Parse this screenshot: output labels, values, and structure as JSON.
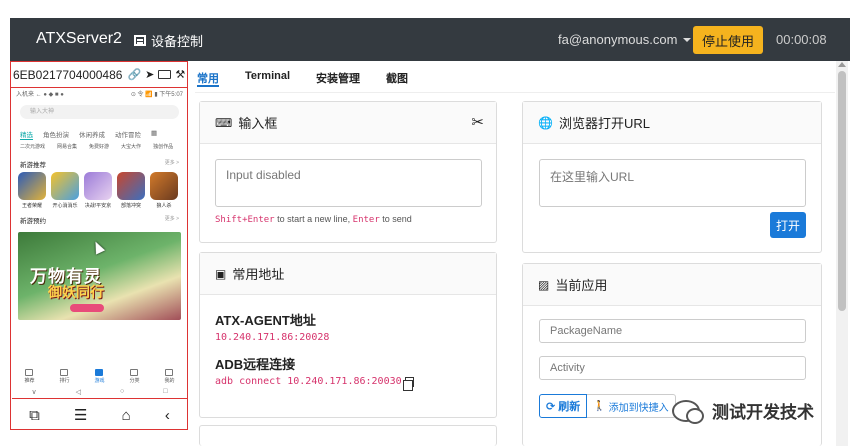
{
  "navbar": {
    "brand": "ATXServer2",
    "device_control_label": "设备控制",
    "user_email": "fa@anonymous.com",
    "stop_button": "停止使用",
    "timer": "00:00:08"
  },
  "device": {
    "serial": "6EB0217704000486",
    "status_left": "入机来 ← ● ◆ ■ ●",
    "status_right": "⊙ 令 📶 ▮ 下午5:07",
    "search_placeholder": "输入大神",
    "app_tabs": [
      "精选",
      "角色扮演",
      "休闲养成",
      "动作冒险"
    ],
    "sub_row": [
      "二次元游戏",
      "网易合集",
      "免费好游",
      "大宝大作",
      "独创作品"
    ],
    "recommend_title": "新游推荐",
    "more": "更多 >",
    "games": [
      {
        "label": "王者荣耀",
        "color": "#2c5bb8"
      },
      {
        "label": "开心消消乐",
        "color": "#f5c22a"
      },
      {
        "label": "决战!平安京",
        "color": "#9b7bd8"
      },
      {
        "label": "部落冲突",
        "color": "#c9462c"
      },
      {
        "label": "狼人杀",
        "color": "#d27a2a"
      }
    ],
    "new_title": "新游预约",
    "banner_line1": "万物有灵",
    "banner_line2": "御妖同行",
    "bottom_tabs": [
      "推荐",
      "排行",
      "游戏",
      "分类",
      "我的"
    ],
    "sys_nav": [
      "∨",
      "◁",
      "○",
      "□"
    ],
    "controls": [
      "⧉",
      "☰",
      "⌂",
      "‹"
    ]
  },
  "tabs": [
    "常用",
    "Terminal",
    "安装管理",
    "截图"
  ],
  "input_card": {
    "title": "输入框",
    "placeholder": "Input disabled",
    "hint_key1": "Shift+Enter",
    "hint_mid": " to start a new line, ",
    "hint_key2": "Enter",
    "hint_end": " to send"
  },
  "address_card": {
    "title": "常用地址",
    "agent_title": "ATX-AGENT地址",
    "agent_value": "10.240.171.86:20028",
    "adb_title": "ADB远程连接",
    "adb_value": "adb connect 10.240.171.86:20030"
  },
  "browser_card": {
    "title": "浏览器打开URL",
    "placeholder": "在这里输入URL",
    "open_button": "打开"
  },
  "app_card": {
    "title": "当前应用",
    "package_placeholder": "PackageName",
    "activity_placeholder": "Activity",
    "refresh_button": "刷新",
    "add_shortcut_button": "添加到快捷入"
  },
  "watermark": "测试开发技术",
  "colors": {
    "navbar_bg": "#343a40",
    "accent_blue": "#1a7ad9",
    "warning_yellow": "#f5b31e",
    "code_pink": "#d6336c",
    "device_border_red": "#dd3333"
  }
}
